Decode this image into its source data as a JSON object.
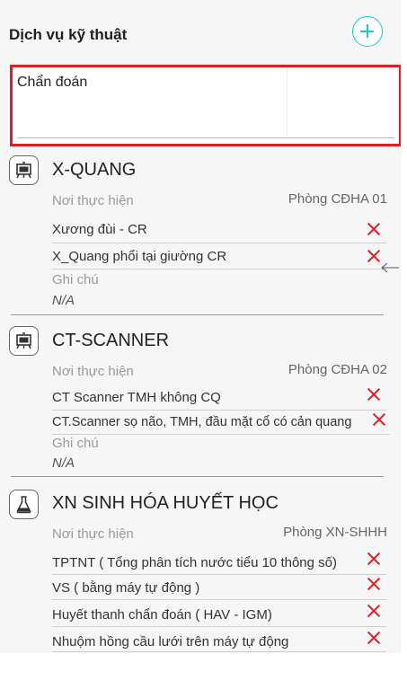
{
  "header": {
    "title": "Dịch vụ kỹ thuật"
  },
  "diagnosis": {
    "text": "Chẩn đoán"
  },
  "sections": [
    {
      "title": "X-QUANG",
      "icon": "monitor-icon",
      "place_label": "Nơi thực hiện",
      "room": "Phòng CĐHA 01",
      "items": [
        "Xương đùi - CR",
        "X_Quang phổi tại giường CR"
      ],
      "note_label": "Ghi chú",
      "note_value": "N/A"
    },
    {
      "title": "CT-SCANNER",
      "icon": "monitor-icon",
      "place_label": "Nơi thực hiện",
      "room": "Phòng CĐHA 02",
      "items": [
        "CT Scanner TMH không CQ",
        "CT.Scanner sọ não, TMH, đầu mặt cổ có cản quang"
      ],
      "note_label": "Ghi chú",
      "note_value": "N/A"
    },
    {
      "title": "XN SINH HÓA HUYẾT HỌC",
      "icon": "flask-icon",
      "place_label": "Nơi thực hiện",
      "room": "Phòng XN-SHHH",
      "items": [
        "TPTNT ( Tổng phân tích nước tiểu 10 thông số)",
        "VS ( bằng máy tự động )",
        "Huyết thanh chẩn đoán ( HAV - IGM)",
        "Nhuộm hồng cầu lưới trên máy tự động"
      ]
    }
  ],
  "colors": {
    "accent": "#1cc4d8",
    "delete": "#e31b23",
    "highlight_border": "#e31b23"
  }
}
